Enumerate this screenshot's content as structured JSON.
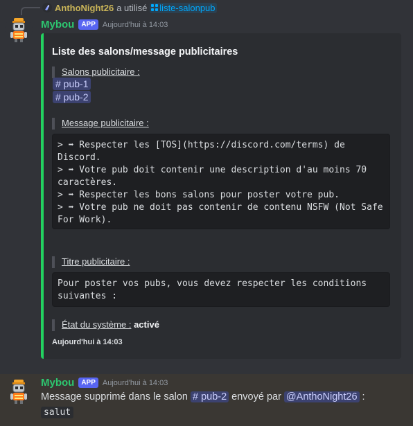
{
  "reply": {
    "user": "AnthoNight26",
    "action": "a utilisé",
    "command": "liste-salonpub"
  },
  "message1": {
    "username": "Mybou",
    "badge": "APP",
    "timestamp": "Aujourd'hui à 14:03",
    "embed": {
      "accent_color": "#23d160",
      "title": "Liste des salons/message publicitaires",
      "salons_label": "Salons publicitaire :",
      "channels": [
        "# pub-1",
        "# pub-2"
      ],
      "message_label": "Message publicitaire :",
      "message_code": "> ➡ Respecter les [TOS](https://discord.com/terms) de Discord.\n> ➡ Votre pub doit contenir une description d'au moins 70 caractères.\n> ➡ Respecter les bons salons pour poster votre pub.\n> ➡ Votre pub ne doit pas contenir de contenu NSFW (Not Safe For Work).",
      "title_label": "Titre publicitaire :",
      "title_code": "Pour poster vos pubs, vous devez respecter les conditions suivantes :",
      "status_label": "État du système :",
      "status_value": "activé",
      "footer": "Aujourd'hui à 14:03"
    }
  },
  "message2": {
    "username": "Mybou",
    "badge": "APP",
    "timestamp": "Aujourd'hui à 14:03",
    "text_before": "Message supprimé dans le salon",
    "channel": "# pub-2",
    "text_middle": "envoyé par",
    "mention": "@AnthoNight26",
    "text_after": ":",
    "code": "salut"
  }
}
